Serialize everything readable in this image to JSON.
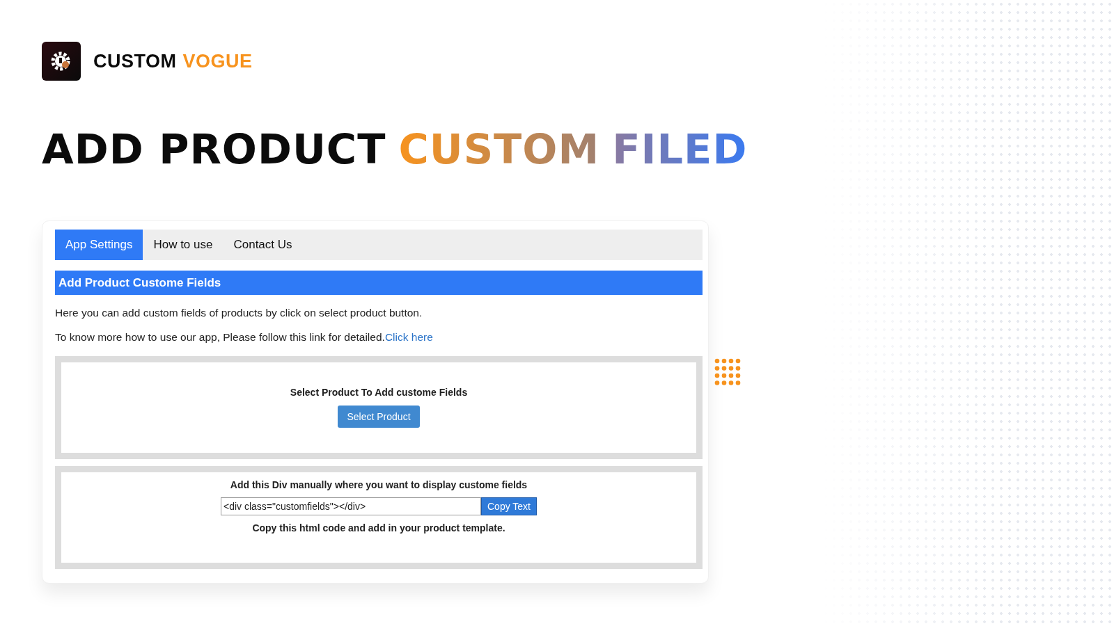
{
  "brand": {
    "name_parts": [
      {
        "text": "CUSTOM",
        "kind": "dark"
      },
      {
        "text": "VOGUE",
        "kind": "accent"
      }
    ]
  },
  "headline": [
    {
      "text": "ADD PRODUCT",
      "kind": "dark"
    },
    {
      "text": "CUSTOM",
      "kind": "warm"
    },
    {
      "text": "FILED",
      "kind": "cool"
    }
  ],
  "app": {
    "tabs": [
      {
        "label": "App Settings",
        "selected": true
      },
      {
        "label": "How to use",
        "selected": false
      },
      {
        "label": "Contact Us",
        "selected": false
      }
    ],
    "section_title": "Add Product Custome Fields",
    "intro": "Here you can add custom fields of products by click on select product button.",
    "more_info": {
      "text": "To know more how to use our app, Please follow this link for detailed.",
      "link": "Click here"
    },
    "select_box": {
      "heading": "Select Product To Add custome Fields",
      "button": "Select Product"
    },
    "code_box": {
      "heading": "Add this Div manually where you want to display custome fields",
      "value": "<div class=\"customfields\"></div>",
      "button": "Copy Text",
      "note": "Copy this html code and add in your product template."
    }
  }
}
